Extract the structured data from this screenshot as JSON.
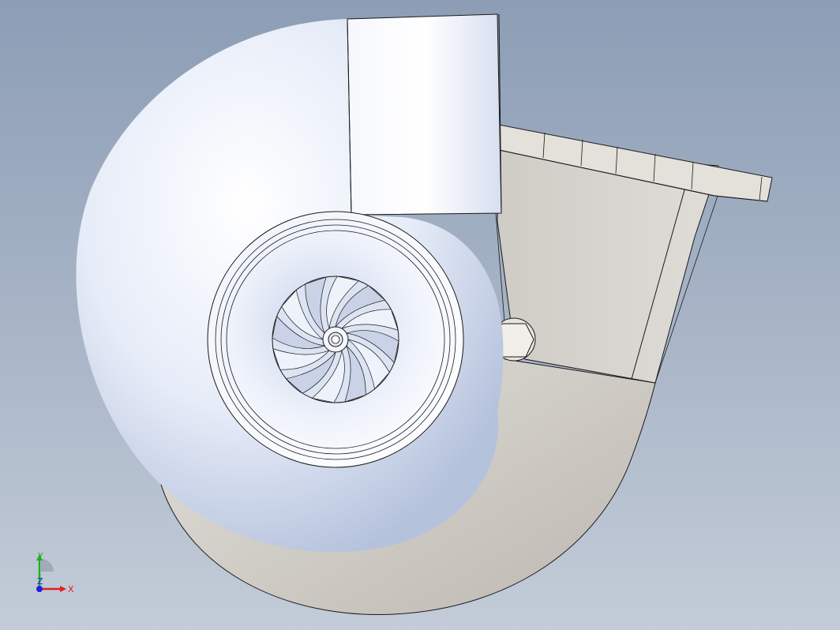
{
  "viewport": {
    "background_top": "#8c9db5",
    "background_bottom": "#c3ccd8"
  },
  "model": {
    "part_colors": {
      "compressor_housing": "#eef2fb",
      "turbine_housing": "#d2cec8",
      "flange": "#e2ded8",
      "outline": "#1a1a1a"
    },
    "impeller_blade_count": 12
  },
  "triad": {
    "x_label": "X",
    "y_label": "Y",
    "z_label": "Z",
    "x_color": "#e02020",
    "y_color": "#20b020",
    "z_color": "#2020e0"
  }
}
